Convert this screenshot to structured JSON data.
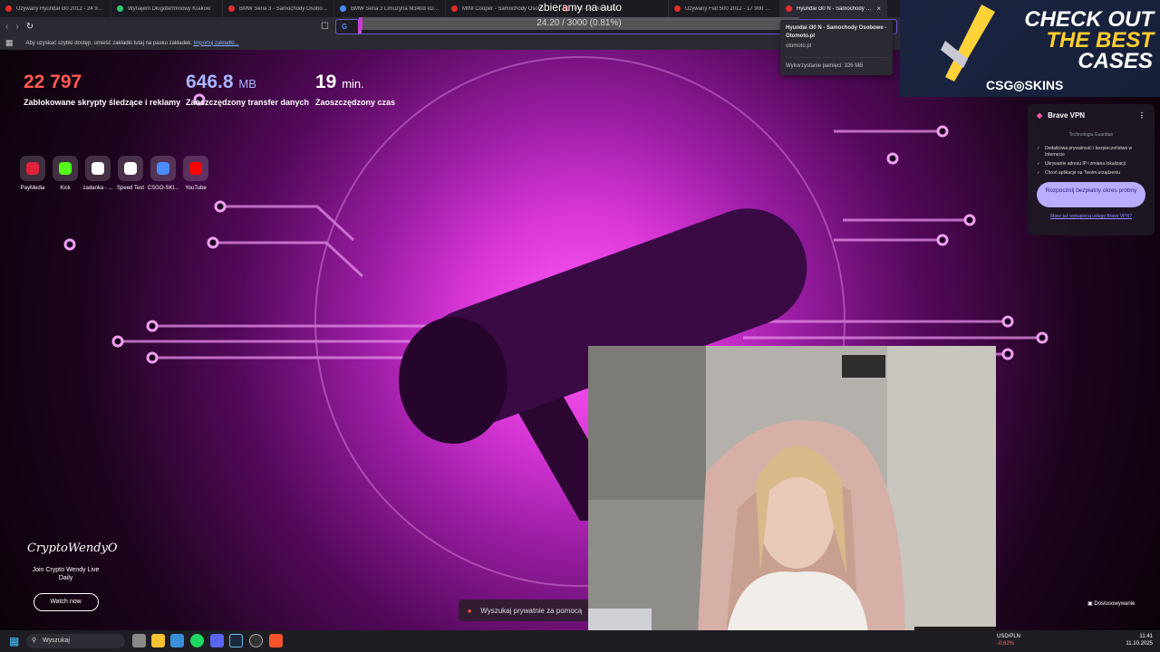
{
  "tabs": [
    {
      "label": "Używany Hyundai i30 2012 - 24 900 PLN",
      "fav": "#e32d2d"
    },
    {
      "label": "Wynajem Długoterminowy Krakow",
      "fav": "#2ecb6f"
    },
    {
      "label": "BMW Seria 3 - Samochody Osobowe",
      "fav": "#e32d2d"
    },
    {
      "label": "BMW Seria 3 Limuzyna M340d xDrive",
      "fav": "#4a8cff"
    },
    {
      "label": "MINI Cooper - Samochody Osobowe",
      "fav": "#e32d2d"
    },
    {
      "label": "008 - 20 000 PLN",
      "fav": "#e32d2d"
    },
    {
      "label": "Używany Fiat 500 2012 - 17 900 PLN",
      "fav": "#e32d2d"
    },
    {
      "label": "Hyundai i30 N - Samochody Os",
      "fav": "#e32d2d",
      "active": true
    }
  ],
  "overlay": {
    "stream_title": "zbieramy na auto",
    "goal_text": "24.20 / 3000 (0.81%)",
    "goal_fraction": 0.0081
  },
  "bookmarks": {
    "hint": "Aby uzyskać szybki dostęp, umieść zakładki tutaj na pasku zakładek.",
    "import": "Importuj zakładki..."
  },
  "hover_card": {
    "title": "Hyundai i30 N - Samochody Osobowe - Otomoto.pl",
    "host": "otomoto.pl",
    "memory": "Wykorzystanie pamięci: 326 MB"
  },
  "stats": [
    {
      "value": "22 797",
      "unit": "",
      "label": "Zablokowane skrypty śledzące i reklamy",
      "color": "#ff5a4f"
    },
    {
      "value": "646.8",
      "unit": "MB",
      "label": "Zaoszczędzony transfer danych",
      "color": "#a8b4ff"
    },
    {
      "value": "19",
      "unit": "min.",
      "label": "Zaoszczędzony czas",
      "color": "#ffffff"
    }
  ],
  "shortcuts": [
    {
      "label": "PayMedia",
      "icon": "play-icon",
      "color": "#e0223b"
    },
    {
      "label": "Kick",
      "icon": "kick-icon",
      "color": "#53fc18"
    },
    {
      "label": "zadanka - ...",
      "icon": "chatgpt-icon",
      "color": "#ffffff"
    },
    {
      "label": "Speed Test",
      "icon": "speedometer-icon",
      "color": "#ffffff"
    },
    {
      "label": "CSGO-SKI...",
      "icon": "target-icon",
      "color": "#4a8cff"
    },
    {
      "label": "YouTube",
      "icon": "youtube-icon",
      "color": "#ff0000"
    }
  ],
  "wendy": {
    "logo": "CryptoWendyO",
    "subtitle": "Join Crypto Wendy Live Daily",
    "button": "Watch now"
  },
  "search_private": "Wyszukaj prywatnie za pomocą",
  "customize": "Dostosowywanie",
  "vpn": {
    "title": "Brave VPN",
    "tech": "Technologia Guardian",
    "features": [
      "Dodatkowa prywatność i bezpieczeństwo w Internecie",
      "Ukrywanie adresu IP i zmiana lokalizacji",
      "Chroń aplikacje na Twoim urządzeniu"
    ],
    "cta": "Rozpocznij bezpłatny okres próbny",
    "link": "Masz już wykupioną usługę Brave VPN?"
  },
  "ad": {
    "line1": "CHECK OUT",
    "line2": "THE BEST",
    "line3": "CASES",
    "brand": "CSG◎SKINS"
  },
  "taskbar": {
    "search": "Wyszukaj",
    "fx_pair": "USD/PLN",
    "fx_change": "-0,62%",
    "time": "11:41",
    "date": "11.10.2025"
  }
}
